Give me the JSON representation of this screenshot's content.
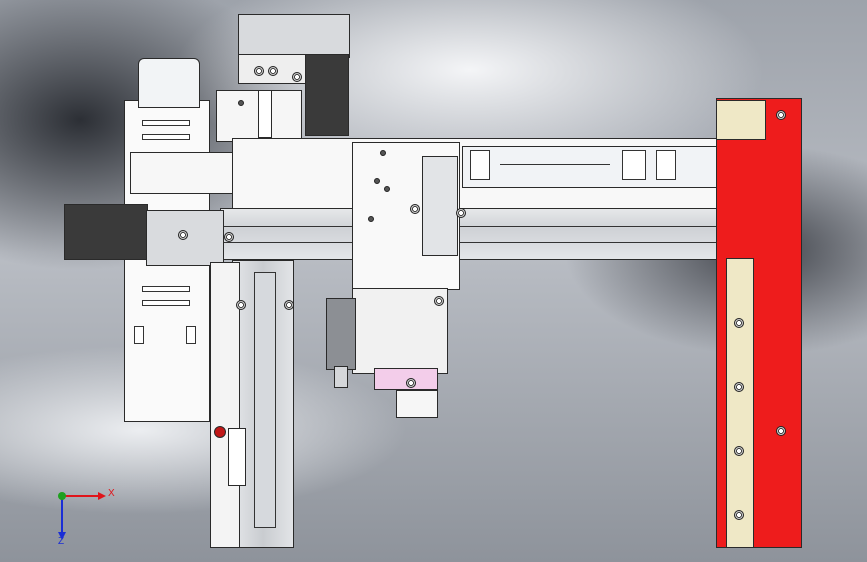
{
  "viewport": {
    "colors": {
      "frame_part": "#f5f5f5",
      "bracket_red": "#ee1c1c",
      "guide_yellow": "#efe8c6",
      "motor_dark": "#3a3a3a",
      "pink_plate": "#f3cdea",
      "axis_x": "#e0141a",
      "axis_y": "#1ea01e",
      "axis_z": "#1a2ed6"
    }
  },
  "triad": {
    "x_label": "X",
    "z_label": "Z",
    "icon": "axis-triad-icon"
  }
}
